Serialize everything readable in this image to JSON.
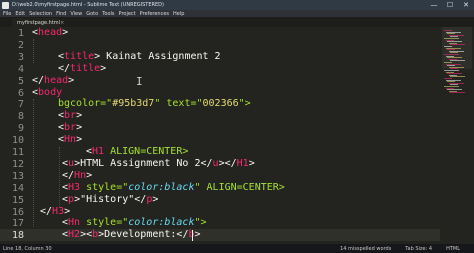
{
  "window": {
    "title": "D:\\web2.0\\myfirstpage.html - Sublime Text (UNREGISTERED)",
    "controls": [
      "—",
      "☐",
      "✕"
    ]
  },
  "menu": [
    "File",
    "Edit",
    "Selection",
    "Find",
    "View",
    "Goto",
    "Tools",
    "Project",
    "Preferences",
    "Help"
  ],
  "tab": {
    "label": "myfirstpage.html",
    "close": "×"
  },
  "editor": {
    "line_numbers": [
      "1",
      "2",
      "3",
      "4",
      "5",
      "6",
      "7",
      "8",
      "9",
      "10",
      "11",
      "12",
      "13",
      "14",
      "15",
      "16",
      "17",
      "18"
    ],
    "lines": [
      [
        "<",
        "head",
        ">"
      ],
      [],
      [
        "<",
        "title",
        "> Kainat Assignment 2"
      ],
      [
        "</",
        "title",
        ">"
      ],
      [
        "</",
        "head",
        ">"
      ],
      [
        "<",
        "body"
      ],
      [
        "bgcolor=\"",
        "#95b3d7",
        "\" text=\"",
        "002366",
        "\">"
      ],
      [
        "<",
        "br",
        ">"
      ],
      [
        "<",
        "br",
        ">"
      ],
      [
        "<",
        "Hn",
        ">"
      ],
      [
        "<",
        "H1",
        " ALIGN=CENTER>"
      ],
      [
        "<",
        "u",
        ">HTML Assignment No 2</",
        "u",
        "></",
        "H1",
        ">"
      ],
      [
        "</",
        "Hn",
        ">"
      ],
      [
        "<",
        "H3",
        " style=\"",
        "color:black",
        "\" ALIGN=CENTER>"
      ],
      [
        "<",
        "p",
        ">\"History\"</",
        "p",
        ">"
      ],
      [
        "</",
        "H3",
        ">"
      ],
      [
        "<",
        "Hn",
        " style=\"",
        "color:black",
        "\">"
      ],
      [
        "<",
        "H2",
        "><",
        "b",
        ">Development:</",
        "b",
        ">"
      ]
    ]
  },
  "status": {
    "position": "Line 18, Column 30",
    "words": "14 misspelled words",
    "tab_size": "Tab Size: 4",
    "syntax": "HTML"
  },
  "colors": {
    "background": "#23241f",
    "tag": "#f92672",
    "string": "#e6db74",
    "text": "#f8f8f2"
  }
}
